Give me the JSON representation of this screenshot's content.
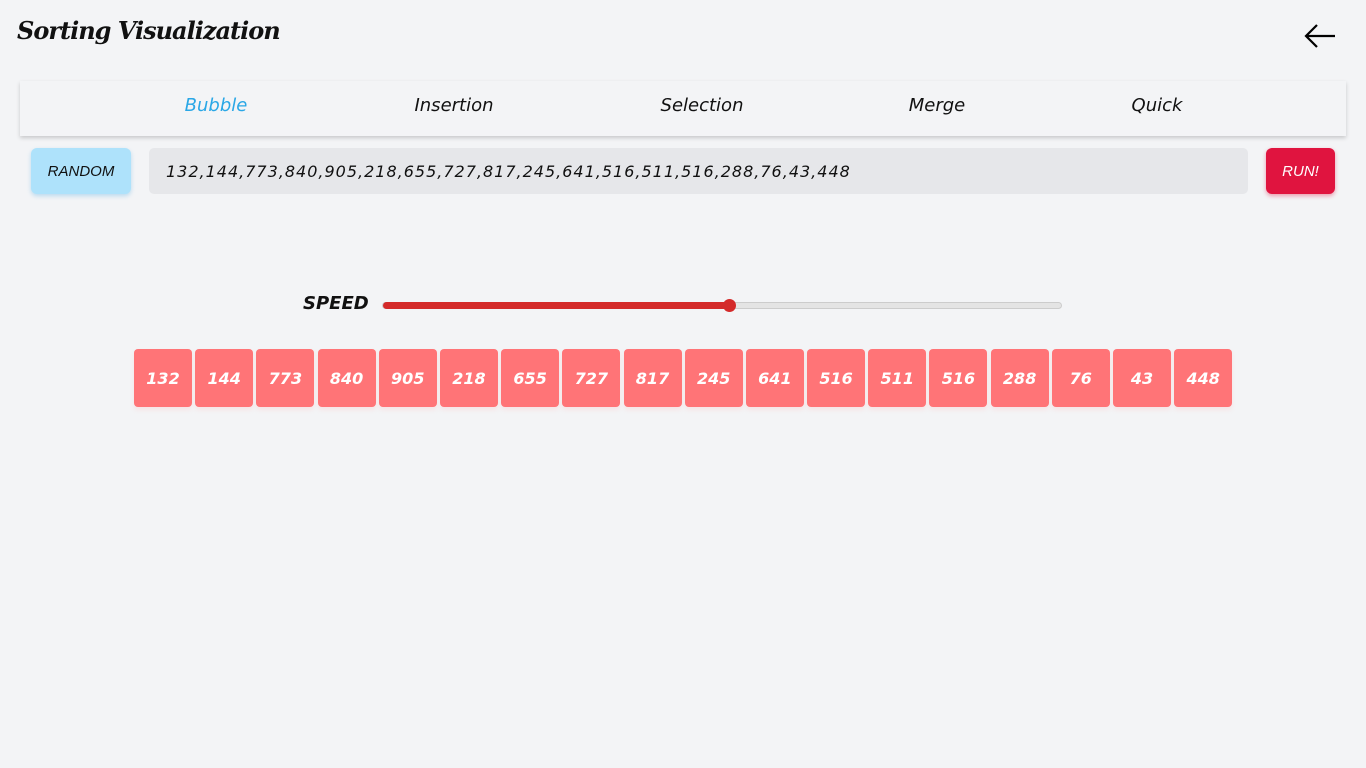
{
  "header": {
    "title": "Sorting Visualization",
    "back_icon": "arrow-left-icon"
  },
  "tabs": [
    {
      "label": "Bubble",
      "active": true
    },
    {
      "label": "Insertion"
    },
    {
      "label": "Selection"
    },
    {
      "label": "Merge"
    },
    {
      "label": "Quick"
    }
  ],
  "controls": {
    "random_label": "RANDOM",
    "array_value": "132,144,773,840,905,218,655,727,817,245,641,516,511,516,288,76,43,448",
    "run_label": "RUN!"
  },
  "speed": {
    "label": "SPEED",
    "value_percent": 51
  },
  "array": [
    132,
    144,
    773,
    840,
    905,
    218,
    655,
    727,
    817,
    245,
    641,
    516,
    511,
    516,
    288,
    76,
    43,
    448
  ],
  "colors": {
    "active_tab": "#2aa7e6",
    "random_button": "#aee2fb",
    "run_button": "#e0143f",
    "slider": "#d42a2a",
    "block": "#ff7477"
  }
}
